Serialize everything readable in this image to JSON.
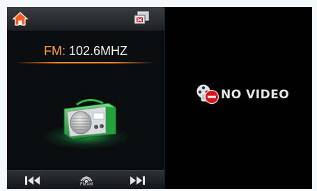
{
  "top_bar": {
    "home_icon": "home-icon",
    "window_icon": "close-window-icon"
  },
  "tuner": {
    "band": "FM:",
    "frequency": "102.6MHZ",
    "radio_icon": "radio-icon"
  },
  "controls": {
    "prev_icon": "skip-previous-icon",
    "band_toggle_label": "FM AM",
    "band_toggle_icon": "signal-icon",
    "next_icon": "skip-next-icon"
  },
  "video": {
    "status_text": "NO VIDEO",
    "status_icon": "no-video-icon"
  },
  "colors": {
    "accent": "#ff9c2a",
    "radio_green": "#2fb84a",
    "no_video_red": "#d8141a"
  }
}
